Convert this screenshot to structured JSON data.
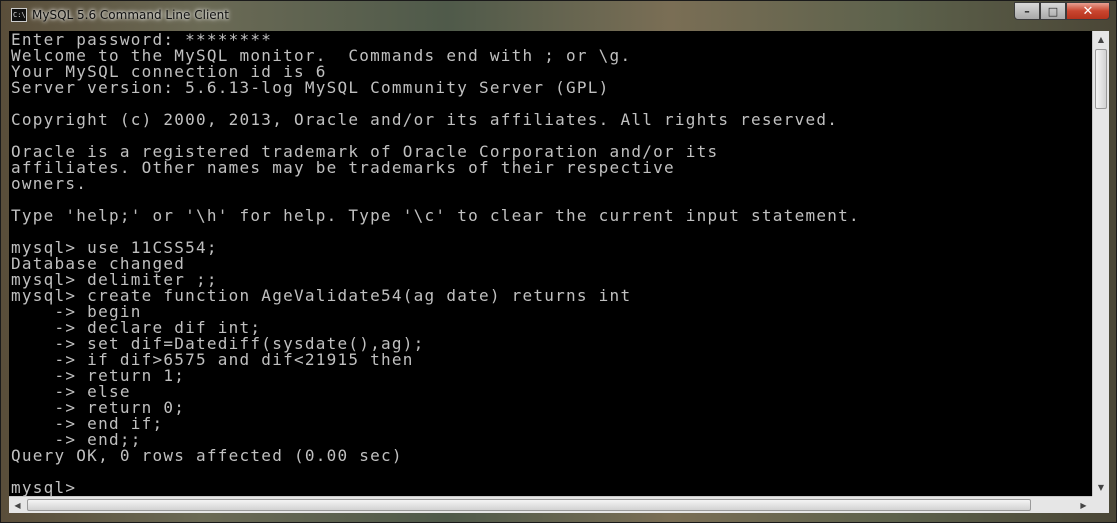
{
  "window": {
    "title": "MySQL 5.6 Command Line Client",
    "icon": "console-app-icon",
    "icon_glyph": "C:\\",
    "minimize_glyph": "–",
    "maximize_glyph": "□",
    "close_glyph": "✕"
  },
  "console": {
    "lines": [
      "Enter password: ********",
      "Welcome to the MySQL monitor.  Commands end with ; or \\g.",
      "Your MySQL connection id is 6",
      "Server version: 5.6.13-log MySQL Community Server (GPL)",
      "",
      "Copyright (c) 2000, 2013, Oracle and/or its affiliates. All rights reserved.",
      "",
      "Oracle is a registered trademark of Oracle Corporation and/or its",
      "affiliates. Other names may be trademarks of their respective",
      "owners.",
      "",
      "Type 'help;' or '\\h' for help. Type '\\c' to clear the current input statement.",
      "",
      "mysql> use 11CSS54;",
      "Database changed",
      "mysql> delimiter ;;",
      "mysql> create function AgeValidate54(ag date) returns int",
      "    -> begin",
      "    -> declare dif int;",
      "    -> set dif=Datediff(sysdate(),ag);",
      "    -> if dif>6575 and dif<21915 then",
      "    -> return 1;",
      "    -> else",
      "    -> return 0;",
      "    -> end if;",
      "    -> end;;",
      "Query OK, 0 rows affected (0.00 sec)",
      "",
      "mysql>"
    ]
  },
  "scrollbars": {
    "up_glyph": "▲",
    "down_glyph": "▼",
    "left_glyph": "◀",
    "right_glyph": "▶"
  }
}
